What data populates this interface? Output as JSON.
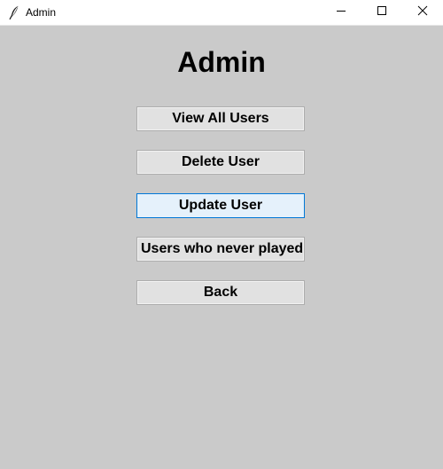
{
  "window": {
    "title": "Admin",
    "controls": {
      "minimize": "minimize-icon",
      "maximize": "maximize-icon",
      "close": "close-icon"
    }
  },
  "page": {
    "heading": "Admin"
  },
  "menu": {
    "buttons": [
      {
        "label": "View All Users",
        "state": "normal"
      },
      {
        "label": "Delete User",
        "state": "normal"
      },
      {
        "label": "Update User",
        "state": "hover"
      },
      {
        "label": "Users who never played",
        "state": "normal"
      },
      {
        "label": "Back",
        "state": "normal"
      }
    ]
  },
  "colors": {
    "background": "#cacaca",
    "button_face": "#e1e1e1",
    "button_hover": "#e5f1fb",
    "focus_border": "#0078d7"
  }
}
